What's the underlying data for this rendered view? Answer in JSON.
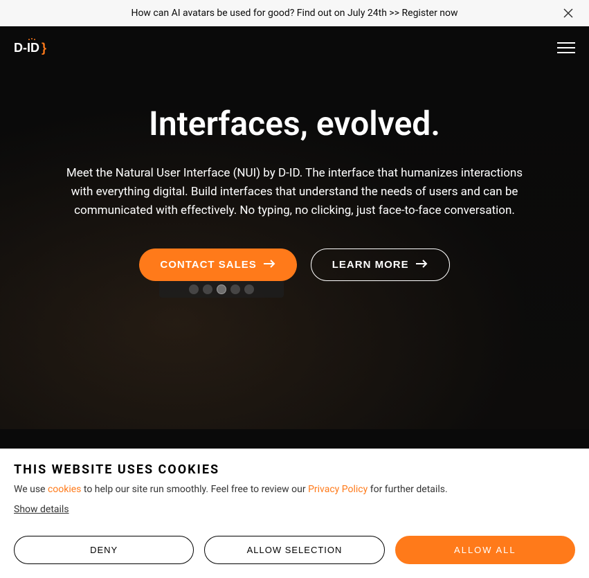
{
  "announcement": {
    "text": "How can AI avatars be used for good? Find out on July 24th >> Register now"
  },
  "logo": {
    "text": "D-ID"
  },
  "hero": {
    "title": "Interfaces, evolved.",
    "description": "Meet the Natural User Interface (NUI) by D-ID. The interface that humanizes interactions with everything digital. Build interfaces that understand the needs of users and can be communicated with effectively. No typing, no clicking, just face-to-face conversation.",
    "buttons": {
      "contact": "CONTACT SALES",
      "learn": "LEARN MORE"
    }
  },
  "cookie": {
    "title": "THIS WEBSITE USES COOKIES",
    "text_prefix": "We use ",
    "cookies_link": "cookies",
    "text_mid": " to help our site run smoothly. Feel free to review our ",
    "privacy_link": "Privacy Policy",
    "text_suffix": " for further details.",
    "show_details": "Show details",
    "deny": "DENY",
    "allow_selection": "ALLOW SELECTION",
    "allow_all": "ALLOW ALL"
  },
  "colors": {
    "accent": "#ff7a1a",
    "dark": "#0a0a0a"
  }
}
